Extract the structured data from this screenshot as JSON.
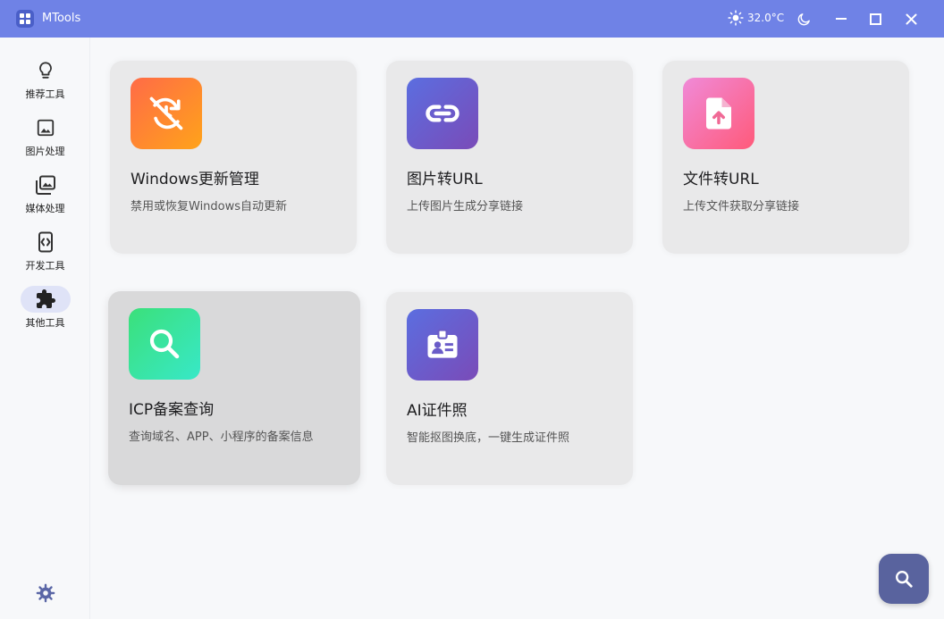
{
  "titlebar": {
    "app_title": "MTools",
    "temperature": "32.0°C",
    "icons": [
      "app-logo-icon",
      "sun-icon",
      "moon-icon",
      "minimize-icon",
      "maximize-icon",
      "close-icon"
    ]
  },
  "sidebar": {
    "items": [
      {
        "label": "推荐工具",
        "icon": "lightbulb-icon"
      },
      {
        "label": "图片处理",
        "icon": "image-icon"
      },
      {
        "label": "媒体处理",
        "icon": "photo-library-icon"
      },
      {
        "label": "开发工具",
        "icon": "code-icon"
      },
      {
        "label": "其他工具",
        "icon": "puzzle-icon",
        "active": true
      }
    ],
    "settings_icon": "gear-icon"
  },
  "cards": [
    {
      "title": "Windows更新管理",
      "desc": "禁用或恢复Windows自动更新",
      "icon": "update-disabled-icon",
      "gradient": [
        "#ff6b47",
        "#ffa31a"
      ]
    },
    {
      "title": "图片转URL",
      "desc": "上传图片生成分享链接",
      "icon": "link-icon",
      "gradient": [
        "#5b6ee0",
        "#7a4bb8"
      ]
    },
    {
      "title": "文件转URL",
      "desc": "上传文件获取分享链接",
      "icon": "file-upload-icon",
      "gradient": [
        "#f08ad8",
        "#ff5a7a"
      ]
    },
    {
      "title": "ICP备案查询",
      "desc": "查询域名、APP、小程序的备案信息",
      "icon": "search-icon",
      "gradient": [
        "#3be07a",
        "#38e8c8"
      ]
    },
    {
      "title": "AI证件照",
      "desc": "智能抠图换底，一键生成证件照",
      "icon": "id-badge-icon",
      "gradient": [
        "#5b6ee0",
        "#7a4bb8"
      ]
    }
  ],
  "fab": {
    "icon": "search-icon"
  },
  "colors": {
    "titlebar": "#6f82e6",
    "accent": "#59639e"
  }
}
